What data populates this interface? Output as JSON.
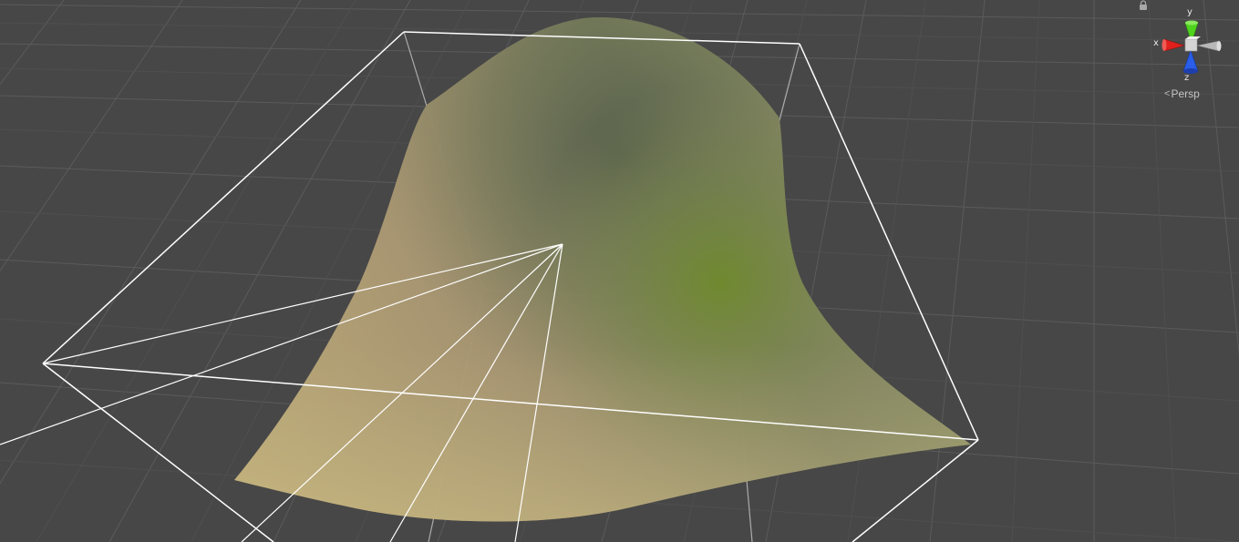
{
  "scene_view": {
    "projection_label": "Persp",
    "background_color": "#474747",
    "grid_color": "#5a5a5a",
    "bounds_color": "#ffffff",
    "surface_colors": {
      "light": "#c9bd86",
      "warm": "#b49a6e",
      "dark": "#5a6440",
      "green": "#6f8a2c"
    }
  },
  "orientation_gizmo": {
    "axes": {
      "x": {
        "label": "x",
        "color": "#e0201d"
      },
      "y": {
        "label": "y",
        "color": "#4fd41d"
      },
      "z": {
        "label": "z",
        "color": "#2a5de8"
      }
    },
    "center_color": "#d4d4d4",
    "icons": [
      "chevron-left-icon",
      "lock-icon"
    ]
  }
}
